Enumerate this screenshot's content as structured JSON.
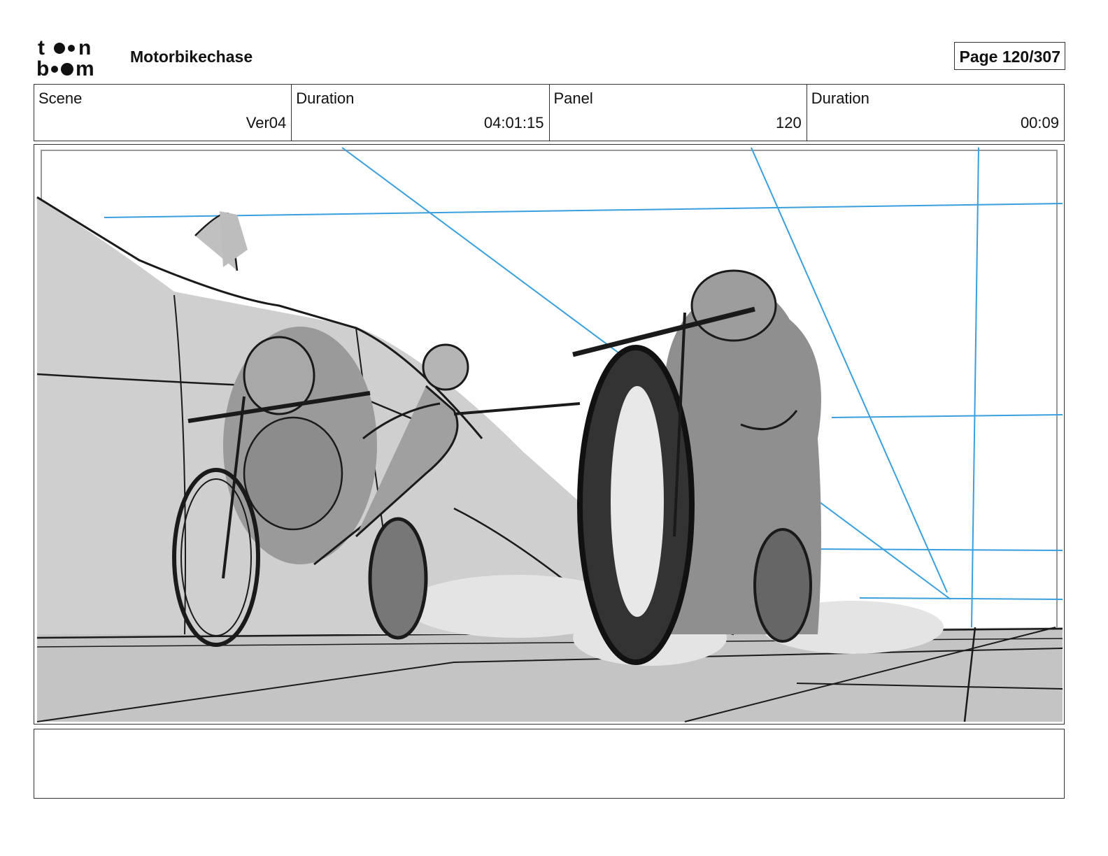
{
  "header": {
    "logo": {
      "line1": "toon",
      "line2": "boom",
      "brand": "Toon Boom"
    },
    "project_title": "Motorbikechase",
    "page_label": "Page 120/307"
  },
  "info": {
    "scene_label": "Scene",
    "scene_value": "Ver04",
    "scene_duration_label": "Duration",
    "scene_duration_value": "04:01:15",
    "panel_label": "Panel",
    "panel_value": "120",
    "panel_duration_label": "Duration",
    "panel_duration_value": "00:09"
  },
  "panel": {
    "image_kind": "storyboard-sketch",
    "colors": {
      "ink": "#1a1a1a",
      "gray_fill": "#c9c9c9",
      "dark_fill": "#555555",
      "guide_blue": "#3aa0dd",
      "dust": "#e6e6e6"
    }
  },
  "notes": {
    "text": ""
  }
}
